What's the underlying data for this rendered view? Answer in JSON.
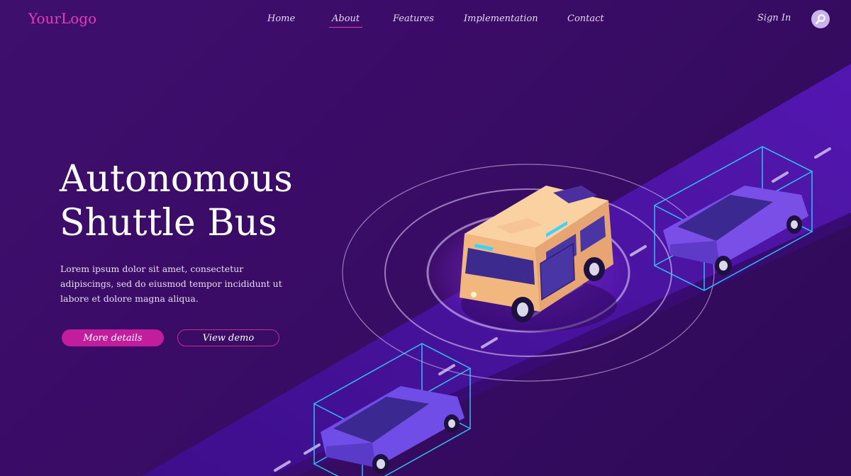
{
  "header": {
    "logo": "YourLogo",
    "nav": [
      "Home",
      "About",
      "Features",
      "Implementation",
      "Contact"
    ],
    "active_nav": "About",
    "sign_in": "Sign In",
    "search_icon": "search-icon"
  },
  "hero": {
    "title_line1": "Autonomous",
    "title_line2": "Shuttle Bus",
    "description": "Lorem ipsum dolor sit amet, consectetur adipiscings, sed do eiusmod tempor incididunt ut labore et dolore magna aliqua.",
    "primary_button": "More details",
    "secondary_button": "View demo"
  },
  "colors": {
    "background": "#3a0c66",
    "accent": "#c11d9c",
    "logo": "#e23db6",
    "road": "#4a12a0",
    "bus": "#f4c08a",
    "car": "#7b4ee0",
    "sensor": "#27c3f0"
  }
}
